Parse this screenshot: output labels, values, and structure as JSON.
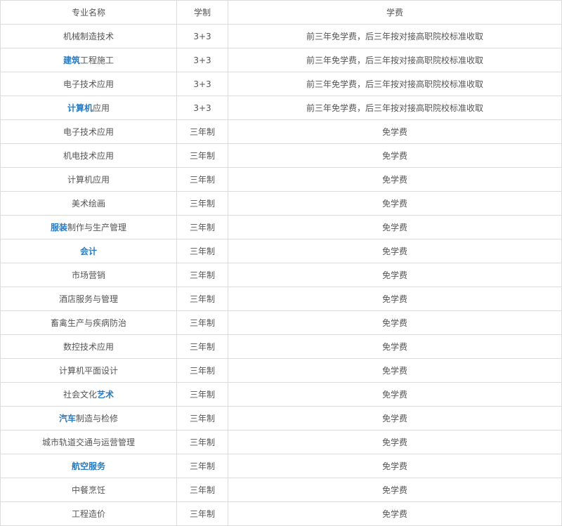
{
  "table": {
    "headers": [
      "专业名称",
      "学制",
      "学费"
    ],
    "rows": [
      {
        "name_link": "",
        "name_rest": "机械制造技术",
        "duration": "3+3",
        "fee": "前三年免学费，后三年按对接高职院校标准收取"
      },
      {
        "name_link": "建筑",
        "name_rest": "工程施工",
        "duration": "3+3",
        "fee": "前三年免学费，后三年按对接高职院校标准收取"
      },
      {
        "name_link": "",
        "name_rest": "电子技术应用",
        "duration": "3+3",
        "fee": "前三年免学费，后三年按对接高职院校标准收取"
      },
      {
        "name_link": "计算机",
        "name_rest": "应用",
        "duration": "3+3",
        "fee": "前三年免学费，后三年按对接高职院校标准收取"
      },
      {
        "name_link": "",
        "name_rest": "电子技术应用",
        "duration": "三年制",
        "fee": "免学费"
      },
      {
        "name_link": "",
        "name_rest": "机电技术应用",
        "duration": "三年制",
        "fee": "免学费"
      },
      {
        "name_link": "",
        "name_rest": "计算机应用",
        "duration": "三年制",
        "fee": "免学费"
      },
      {
        "name_link": "",
        "name_rest": "美术绘画",
        "duration": "三年制",
        "fee": "免学费"
      },
      {
        "name_link": "服装",
        "name_rest": "制作与生产管理",
        "duration": "三年制",
        "fee": "免学费"
      },
      {
        "name_link": "会计",
        "name_rest": "",
        "duration": "三年制",
        "fee": "免学费"
      },
      {
        "name_link": "",
        "name_rest": "市场营销",
        "duration": "三年制",
        "fee": "免学费"
      },
      {
        "name_link": "",
        "name_rest": "酒店服务与管理",
        "duration": "三年制",
        "fee": "免学费"
      },
      {
        "name_link": "",
        "name_rest": "畜禽生产与疾病防治",
        "duration": "三年制",
        "fee": "免学费"
      },
      {
        "name_link": "",
        "name_rest": "数控技术应用",
        "duration": "三年制",
        "fee": "免学费"
      },
      {
        "name_link": "",
        "name_rest": "计算机平面设计",
        "duration": "三年制",
        "fee": "免学费"
      },
      {
        "name_prefix": "社会文化",
        "name_link": "艺术",
        "name_rest": "",
        "duration": "三年制",
        "fee": "免学费"
      },
      {
        "name_link": "汽车",
        "name_rest": "制造与检修",
        "duration": "三年制",
        "fee": "免学费"
      },
      {
        "name_link": "",
        "name_rest": "城市轨道交通与运营管理",
        "duration": "三年制",
        "fee": "免学费"
      },
      {
        "name_link": "航空服务",
        "name_rest": "",
        "duration": "三年制",
        "fee": "免学费"
      },
      {
        "name_link": "",
        "name_rest": "中餐烹饪",
        "duration": "三年制",
        "fee": "免学费"
      },
      {
        "name_link": "",
        "name_rest": "工程造价",
        "duration": "三年制",
        "fee": "免学费"
      }
    ]
  }
}
